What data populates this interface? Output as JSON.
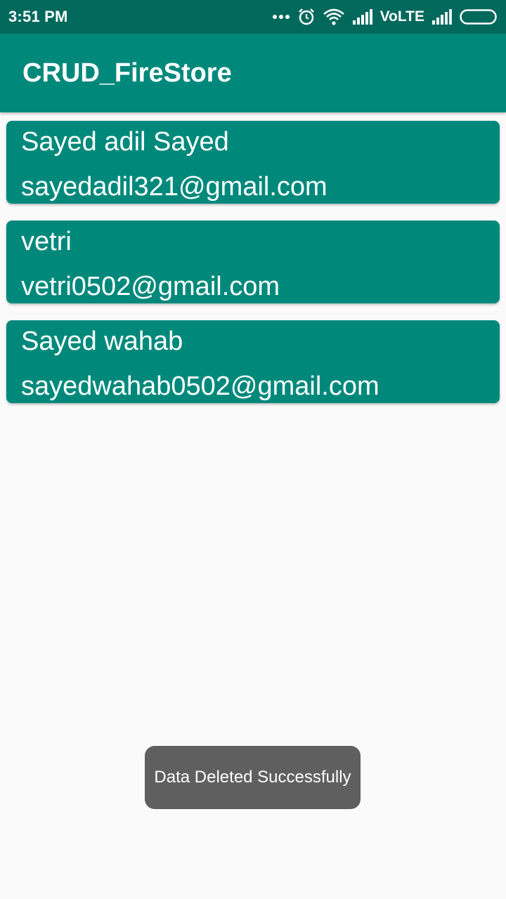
{
  "status_bar": {
    "time": "3:51 PM",
    "network_label": "VoLTE",
    "icons": [
      "more-dots-icon",
      "alarm-icon",
      "wifi-icon",
      "signal-icon",
      "battery-icon"
    ]
  },
  "app_bar": {
    "title": "CRUD_FireStore"
  },
  "users": [
    {
      "name": "Sayed adil Sayed",
      "email": "sayedadil321@gmail.com"
    },
    {
      "name": "vetri",
      "email": "vetri0502@gmail.com"
    },
    {
      "name": "Sayed wahab",
      "email": "sayedwahab0502@gmail.com"
    }
  ],
  "toast": {
    "message": "Data Deleted Successfully"
  },
  "colors": {
    "status_bar": "#00695c",
    "primary": "#00897b",
    "background": "#fafafa",
    "toast": "#5f5f5f"
  }
}
